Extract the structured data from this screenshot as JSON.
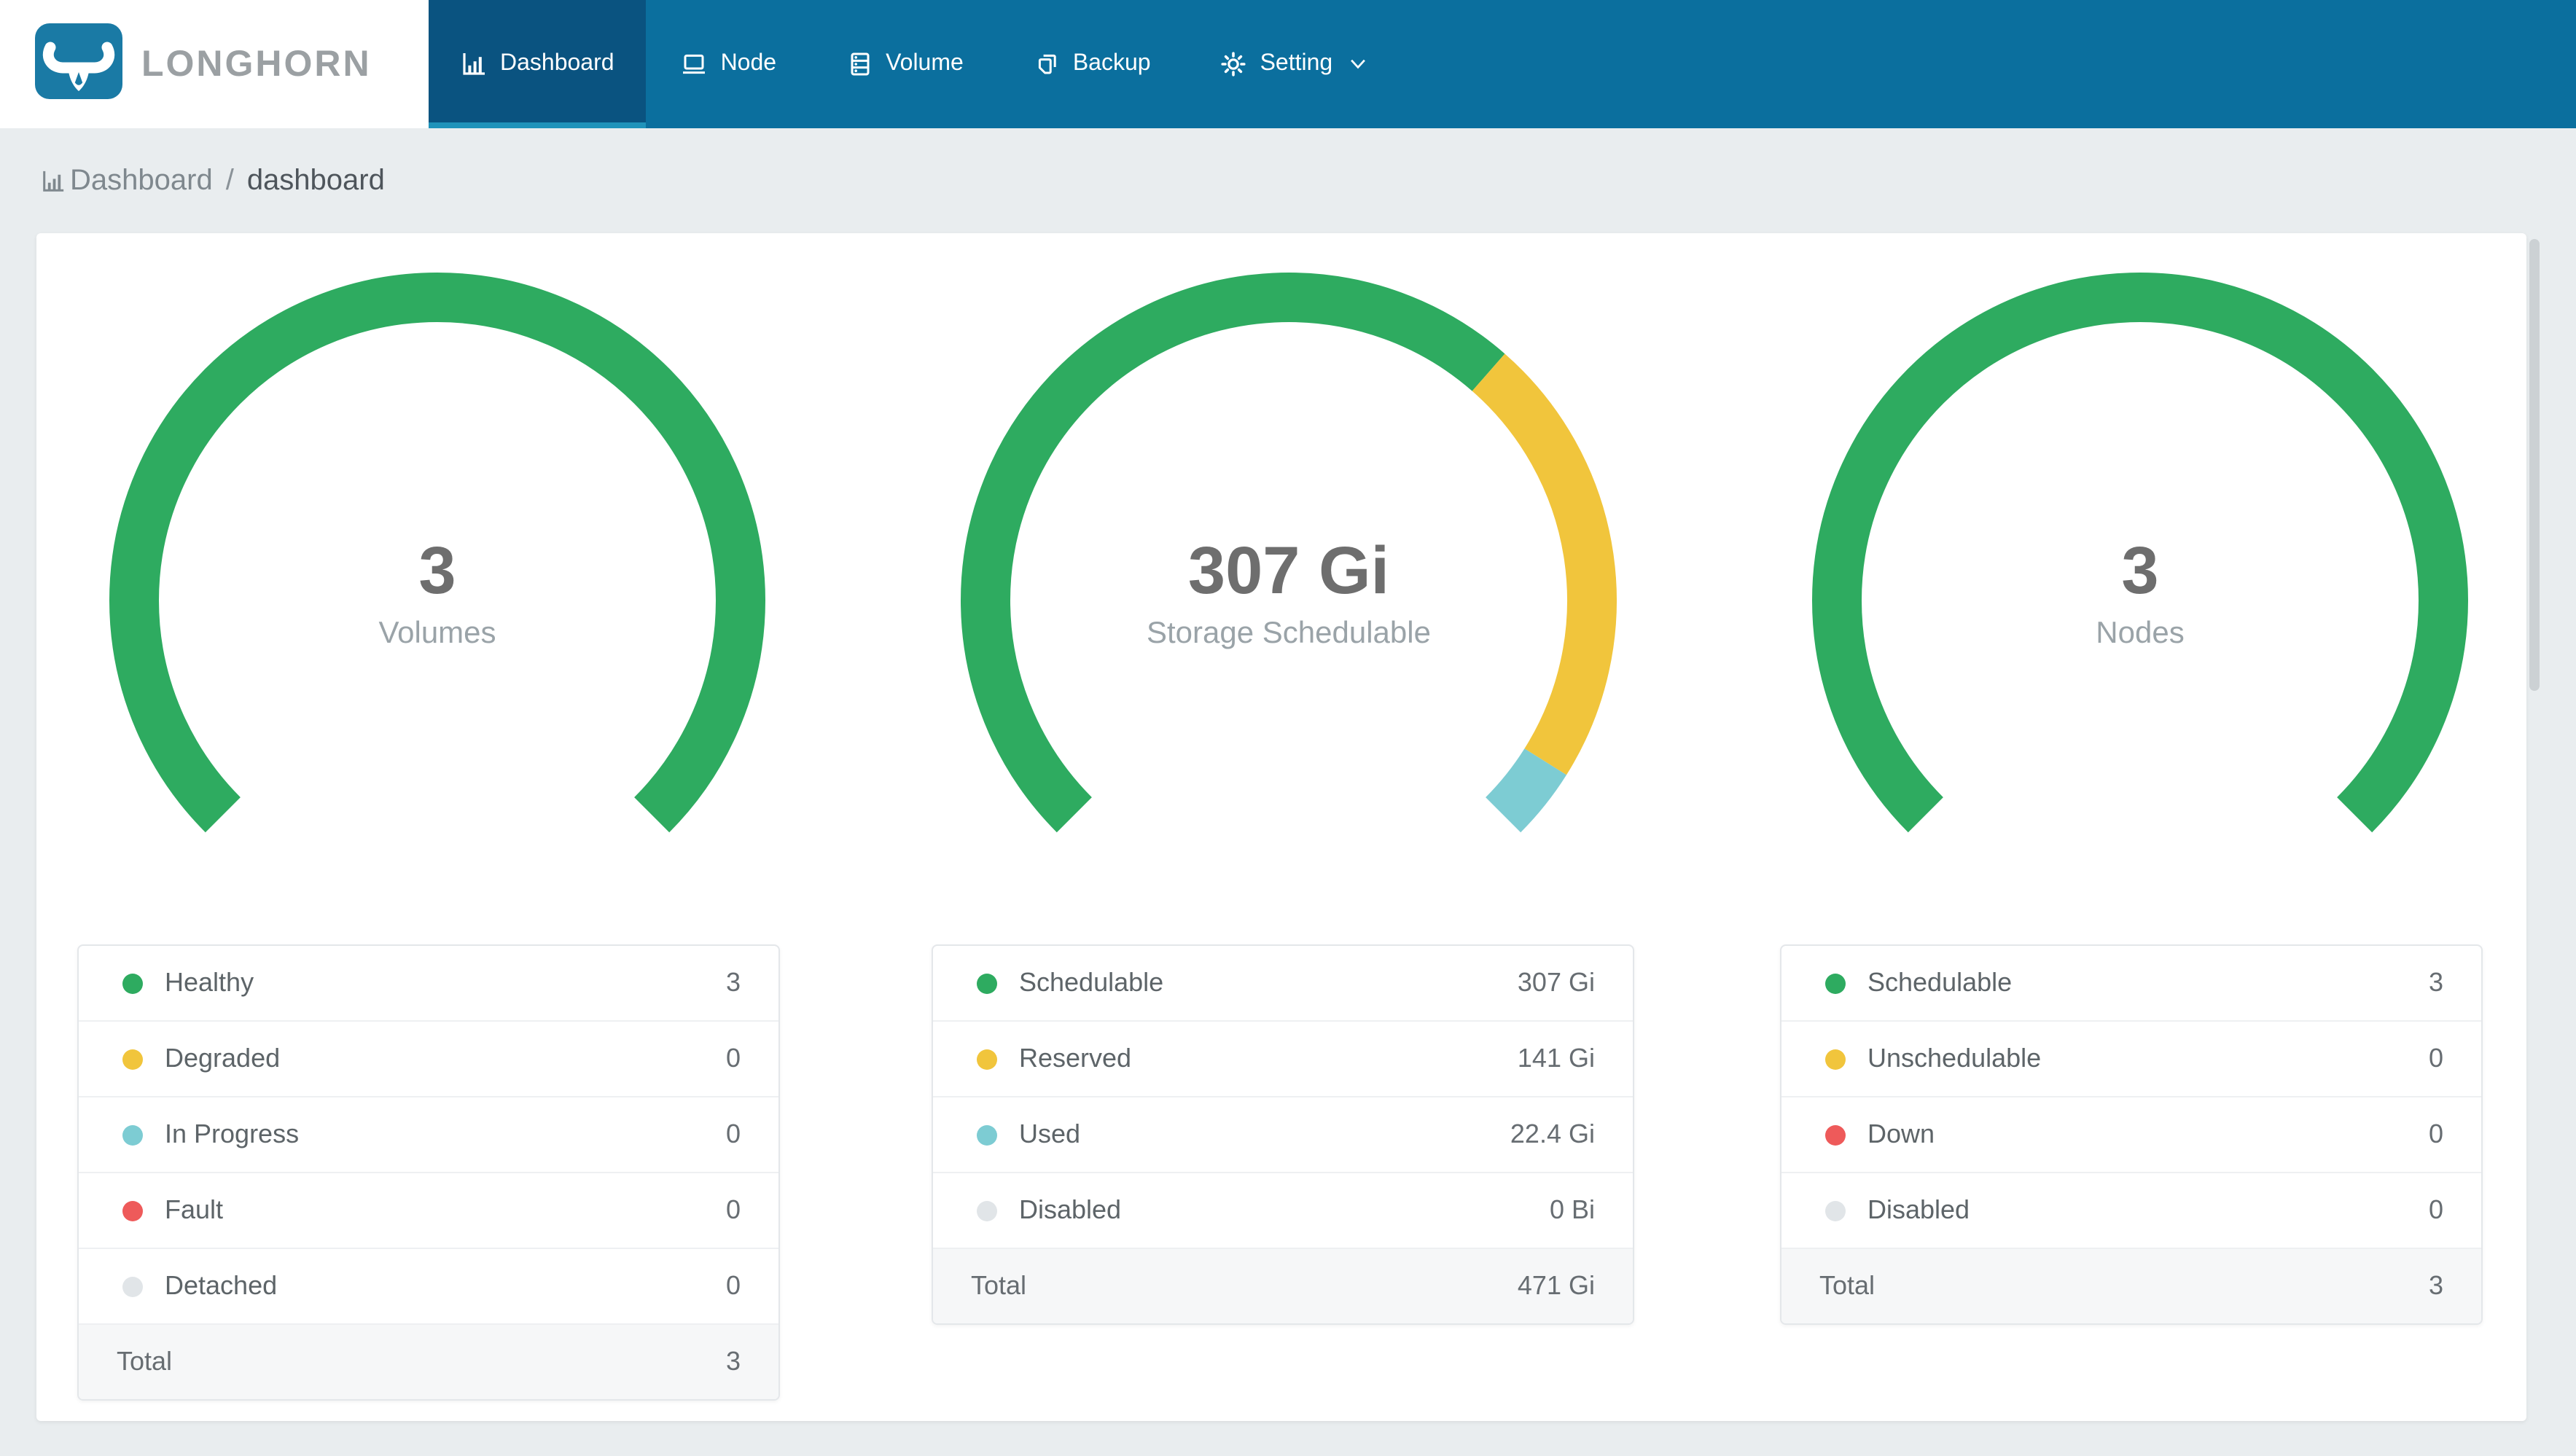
{
  "navbar": {
    "brand": "LONGHORN",
    "items": [
      {
        "id": "dashboard",
        "label": "Dashboard",
        "icon": "bar-chart-icon",
        "active": true,
        "caret": false
      },
      {
        "id": "node",
        "label": "Node",
        "icon": "laptop-icon",
        "active": false,
        "caret": false
      },
      {
        "id": "volume",
        "label": "Volume",
        "icon": "database-icon",
        "active": false,
        "caret": false
      },
      {
        "id": "backup",
        "label": "Backup",
        "icon": "copy-icon",
        "active": false,
        "caret": false
      },
      {
        "id": "setting",
        "label": "Setting",
        "icon": "gear-icon",
        "active": false,
        "caret": true
      }
    ]
  },
  "breadcrumb": {
    "root": "Dashboard",
    "separator": "/",
    "current": "dashboard"
  },
  "colors": {
    "navbar_bg": "#0b6f9e",
    "navbar_active_bg": "#0a5380",
    "navbar_active_indicator": "#2093ba",
    "brand_blue": "#1a7aa5",
    "page_bg": "#e9edef",
    "healthy_green": "#2eab60",
    "degraded_yellow": "#f1c53c",
    "inprogress_teal": "#7dccd3",
    "fault_red": "#ee5a5a",
    "detached_gray": "#e1e5e8"
  },
  "chart_data": [
    {
      "type": "gauge",
      "title": "Volumes",
      "center_value": "3",
      "center_label": "Volumes",
      "arc_degrees": 270,
      "segments": [
        {
          "name": "Healthy",
          "value": 3,
          "color": "#2eab60"
        }
      ]
    },
    {
      "type": "gauge",
      "title": "Storage Schedulable",
      "center_value": "307 Gi",
      "center_label": "Storage Schedulable",
      "arc_degrees": 270,
      "segments": [
        {
          "name": "Schedulable",
          "value": 307,
          "color": "#2eab60"
        },
        {
          "name": "Reserved",
          "value": 141,
          "color": "#f1c53c"
        },
        {
          "name": "Used",
          "value": 22.4,
          "color": "#7dccd3"
        }
      ]
    },
    {
      "type": "gauge",
      "title": "Nodes",
      "center_value": "3",
      "center_label": "Nodes",
      "arc_degrees": 270,
      "segments": [
        {
          "name": "Schedulable",
          "value": 3,
          "color": "#2eab60"
        }
      ]
    }
  ],
  "legend_tables": [
    {
      "id": "volumes",
      "rows": [
        {
          "label": "Healthy",
          "color": "#2eab60",
          "value": "3"
        },
        {
          "label": "Degraded",
          "color": "#f1c53c",
          "value": "0"
        },
        {
          "label": "In Progress",
          "color": "#7dccd3",
          "value": "0"
        },
        {
          "label": "Fault",
          "color": "#ee5a5a",
          "value": "0"
        },
        {
          "label": "Detached",
          "color": "#e1e5e8",
          "value": "0"
        }
      ],
      "total_label": "Total",
      "total_value": "3"
    },
    {
      "id": "storage",
      "rows": [
        {
          "label": "Schedulable",
          "color": "#2eab60",
          "value": "307 Gi"
        },
        {
          "label": "Reserved",
          "color": "#f1c53c",
          "value": "141 Gi"
        },
        {
          "label": "Used",
          "color": "#7dccd3",
          "value": "22.4 Gi"
        },
        {
          "label": "Disabled",
          "color": "#e1e5e8",
          "value": "0 Bi"
        }
      ],
      "total_label": "Total",
      "total_value": "471 Gi"
    },
    {
      "id": "nodes",
      "rows": [
        {
          "label": "Schedulable",
          "color": "#2eab60",
          "value": "3"
        },
        {
          "label": "Unschedulable",
          "color": "#f1c53c",
          "value": "0"
        },
        {
          "label": "Down",
          "color": "#ee5a5a",
          "value": "0"
        },
        {
          "label": "Disabled",
          "color": "#e1e5e8",
          "value": "0"
        }
      ],
      "total_label": "Total",
      "total_value": "3"
    }
  ]
}
